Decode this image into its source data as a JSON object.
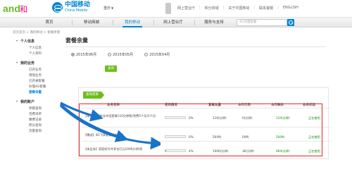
{
  "header": {
    "brand_logo_text": "and和",
    "brand_cn": "中国移动",
    "brand_en": "China Mobile",
    "city": "重庆",
    "top_links": [
      "网上营业厅",
      "积分商城",
      "关于中国移动",
      "联系客服",
      "ENGLISH"
    ]
  },
  "nav": {
    "items": [
      "首页",
      "移动商城",
      "我的移动",
      "网上营业厅",
      "服务与支持"
    ],
    "active_index": 2,
    "search_placeholder": "4G流量套餐"
  },
  "breadcrumb": "首页首页 > 我的移动 > 套餐余量",
  "sidebar": {
    "groups": [
      {
        "title": "个人信息",
        "items": [
          "个人信息",
          "个人资料"
        ]
      },
      {
        "title": "我的业务",
        "items": [
          "已开业务",
          "增值业务",
          "已开通套餐",
          "办理4G套餐",
          "套餐余量"
        ]
      },
      {
        "title": "我的账户",
        "items": [
          "余额查询",
          "话费详单",
          "缴费记录",
          "积分查询",
          "流量查询"
        ]
      }
    ],
    "active_item": "套餐余量"
  },
  "main": {
    "title": "套餐余量",
    "months": [
      "2015年06月",
      "2015年05月",
      "2015年04月"
    ],
    "selected_month_index": 0,
    "query_button": "查询",
    "result_tab": "查询结果"
  },
  "table": {
    "headers": [
      "业务名称",
      "使用情况",
      "套餐总量",
      "本月已用",
      "本月剩余",
      "业务状态"
    ],
    "rows": [
      {
        "name": "【本市】4G新长市话套餐110分钟版(免费5个月)1个月",
        "percent": 0,
        "pct_label": "0%",
        "total": "110(分钟)",
        "used": "0(分钟)",
        "left": "110(分钟)",
        "status": "正在使用"
      },
      {
        "name": "【赠送】4G飞享套餐省内流量",
        "percent": 0,
        "pct_label": "0%",
        "total": "50(M)",
        "used": "0(M)",
        "left": "50(M)",
        "status": "正在使用"
      },
      {
        "name": "【本业务】家庭短号共享包打元1000分钟/家",
        "percent": 4,
        "pct_label": "4%",
        "total": "1000(分钟)",
        "used": "36(分钟)",
        "left": "964(分钟)",
        "status": "正在使用"
      }
    ]
  },
  "colors": {
    "brand_blue": "#0085d0",
    "accent_green": "#6ebd1c",
    "highlight_red": "#e8242c"
  }
}
